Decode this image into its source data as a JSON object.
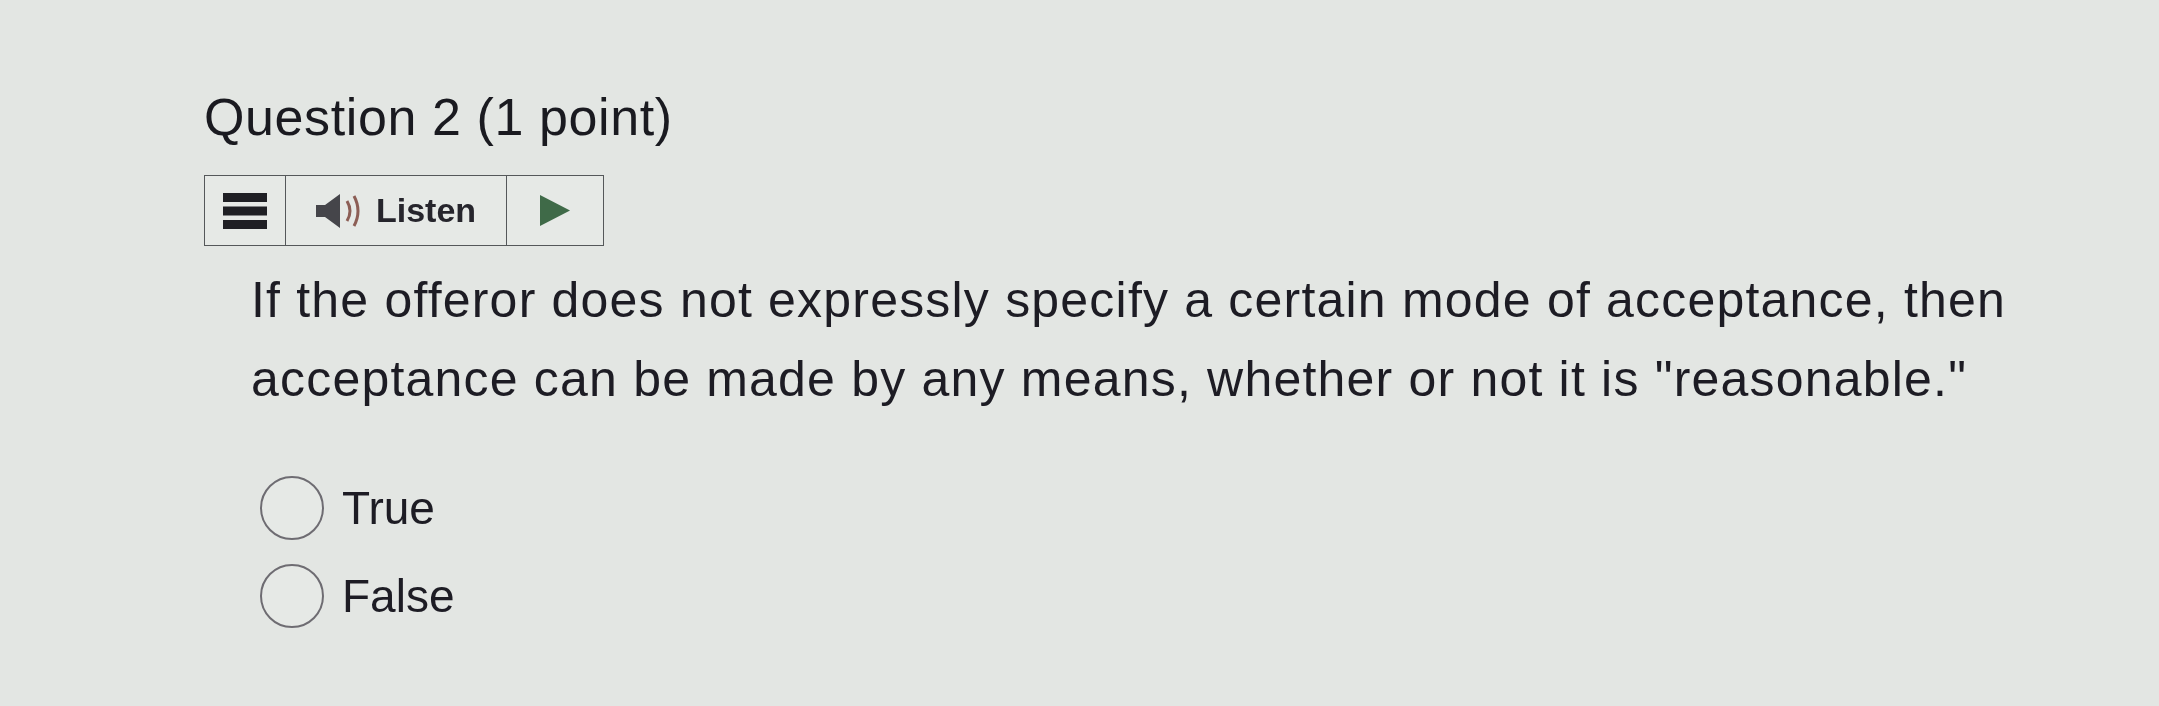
{
  "question": {
    "title": "Question 2 (1 point)",
    "toolbar": {
      "listen_label": "Listen"
    },
    "text": "If the offeror does not expressly specify a certain mode of acceptance, then acceptance can be made by any means, whether or not it is \"reasonable.\"",
    "options": [
      {
        "label": "True",
        "selected": false
      },
      {
        "label": "False",
        "selected": false
      }
    ]
  }
}
